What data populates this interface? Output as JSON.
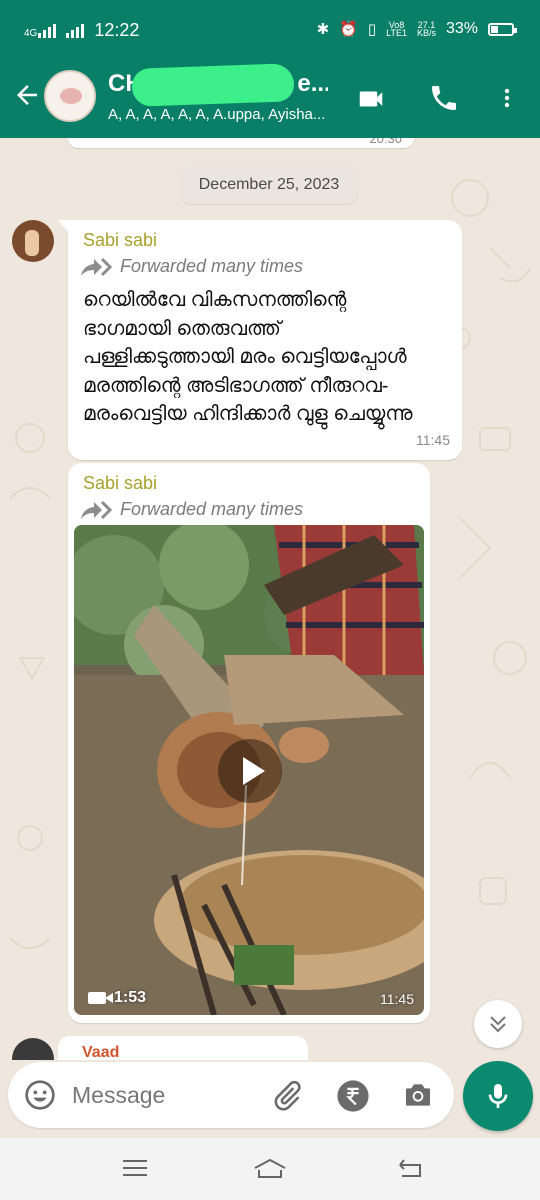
{
  "status": {
    "network": "4G",
    "time": "12:22",
    "volte": "Vo8\nLTE1",
    "speed": "27.1\nKB/s",
    "battery": "33%"
  },
  "header": {
    "title": "CHI",
    "title_suffix": "e...",
    "members": "A, A, A, A, A, A, A.uppa, Ayisha...",
    "icons": [
      "back-arrow-icon",
      "video-call-icon",
      "phone-icon",
      "more-vert-icon"
    ]
  },
  "chat": {
    "previous_time": "20:30",
    "date_chip": "December 25, 2023",
    "messages": [
      {
        "sender": "Sabi sabi",
        "forward_label": "Forwarded many times",
        "text": "റെയിൽവേ വികസനത്തിന്റെ ഭാഗമായി തെരുവത്ത് പള്ളിക്കടുത്തായി മരം വെട്ടിയപ്പോൾ മരത്തിന്റെ അടിഭാഗത്ത് നീരുറവ-മരംവെട്ടിയ ഹിന്ദിക്കാർ വുളു ചെയ്യുന്നു",
        "time": "11:45"
      },
      {
        "sender": "Sabi sabi",
        "forward_label": "Forwarded many times",
        "video_duration": "1:53",
        "time": "11:45"
      }
    ],
    "next_sender": "Vaad"
  },
  "composer": {
    "placeholder": "Message",
    "icons": [
      "emoji-icon",
      "attach-icon",
      "rupee-icon",
      "camera-icon",
      "mic-icon"
    ]
  },
  "colors": {
    "header_bg": "#0a7f67",
    "chat_bg": "#efe7dd",
    "sender_name": "#a8a12c",
    "mic_bg": "#0a8a6e"
  }
}
